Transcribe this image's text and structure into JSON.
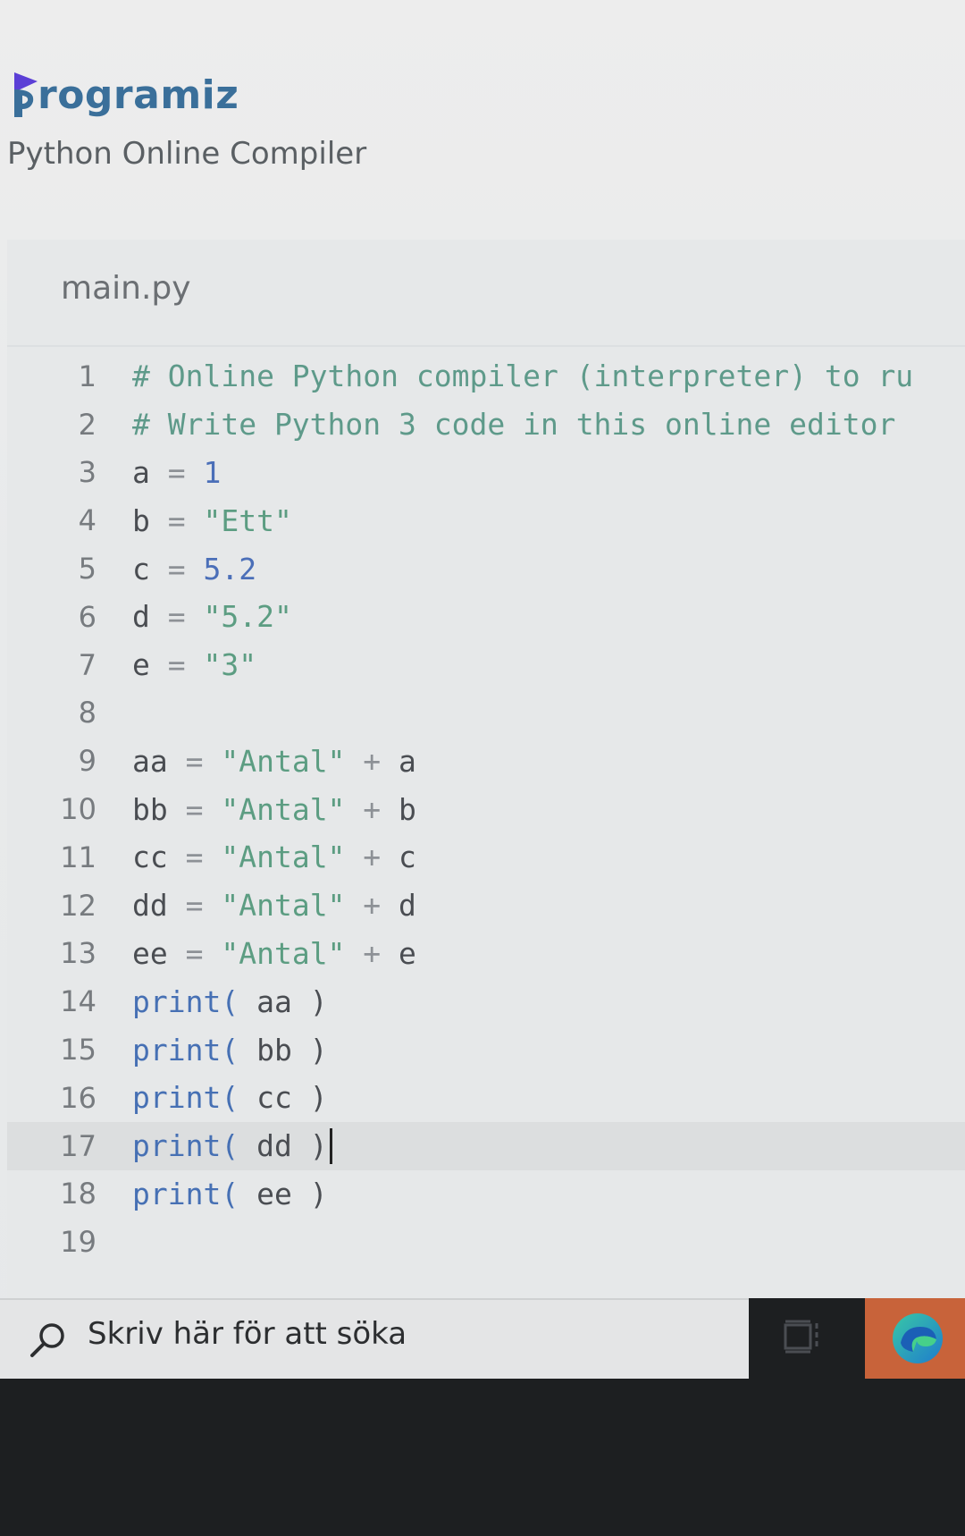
{
  "header": {
    "logo_text": "rogramiz",
    "subtitle": "Python Online Compiler"
  },
  "editor": {
    "file_tab": "main.py",
    "active_line": 17,
    "lines": [
      {
        "n": "1",
        "tokens": [
          {
            "t": "# Online Python compiler (interpreter) to ru",
            "c": "comment"
          }
        ]
      },
      {
        "n": "2",
        "tokens": [
          {
            "t": "# Write Python 3 code in this online editor",
            "c": "comment"
          }
        ]
      },
      {
        "n": "3",
        "tokens": [
          {
            "t": "a ",
            "c": "plain"
          },
          {
            "t": "=",
            "c": "op"
          },
          {
            "t": " 1",
            "c": "num"
          }
        ]
      },
      {
        "n": "4",
        "tokens": [
          {
            "t": "b ",
            "c": "plain"
          },
          {
            "t": "=",
            "c": "op"
          },
          {
            "t": " \"Ett\"",
            "c": "str"
          }
        ]
      },
      {
        "n": "5",
        "tokens": [
          {
            "t": "c ",
            "c": "plain"
          },
          {
            "t": "=",
            "c": "op"
          },
          {
            "t": " 5.2",
            "c": "num"
          }
        ]
      },
      {
        "n": "6",
        "tokens": [
          {
            "t": "d ",
            "c": "plain"
          },
          {
            "t": "=",
            "c": "op"
          },
          {
            "t": " \"5.2\"",
            "c": "str"
          }
        ]
      },
      {
        "n": "7",
        "tokens": [
          {
            "t": "e ",
            "c": "plain"
          },
          {
            "t": "=",
            "c": "op"
          },
          {
            "t": " \"3\"",
            "c": "str"
          }
        ]
      },
      {
        "n": "8",
        "tokens": []
      },
      {
        "n": "9",
        "tokens": [
          {
            "t": "aa ",
            "c": "plain"
          },
          {
            "t": "=",
            "c": "op"
          },
          {
            "t": " \"Antal\"",
            "c": "str"
          },
          {
            "t": " + ",
            "c": "op"
          },
          {
            "t": "a",
            "c": "plain"
          }
        ]
      },
      {
        "n": "10",
        "tokens": [
          {
            "t": "bb ",
            "c": "plain"
          },
          {
            "t": "=",
            "c": "op"
          },
          {
            "t": " \"Antal\"",
            "c": "str"
          },
          {
            "t": " + ",
            "c": "op"
          },
          {
            "t": "b",
            "c": "plain"
          }
        ]
      },
      {
        "n": "11",
        "tokens": [
          {
            "t": "cc ",
            "c": "plain"
          },
          {
            "t": "=",
            "c": "op"
          },
          {
            "t": " \"Antal\"",
            "c": "str"
          },
          {
            "t": " + ",
            "c": "op"
          },
          {
            "t": "c",
            "c": "plain"
          }
        ]
      },
      {
        "n": "12",
        "tokens": [
          {
            "t": "dd ",
            "c": "plain"
          },
          {
            "t": "=",
            "c": "op"
          },
          {
            "t": " \"Antal\"",
            "c": "str"
          },
          {
            "t": " + ",
            "c": "op"
          },
          {
            "t": "d",
            "c": "plain"
          }
        ]
      },
      {
        "n": "13",
        "tokens": [
          {
            "t": "ee ",
            "c": "plain"
          },
          {
            "t": "=",
            "c": "op"
          },
          {
            "t": " \"Antal\"",
            "c": "str"
          },
          {
            "t": " + ",
            "c": "op"
          },
          {
            "t": "e",
            "c": "plain"
          }
        ]
      },
      {
        "n": "14",
        "tokens": [
          {
            "t": "print(",
            "c": "func"
          },
          {
            "t": " aa )",
            "c": "plain"
          }
        ]
      },
      {
        "n": "15",
        "tokens": [
          {
            "t": "print(",
            "c": "func"
          },
          {
            "t": " bb )",
            "c": "plain"
          }
        ]
      },
      {
        "n": "16",
        "tokens": [
          {
            "t": "print(",
            "c": "func"
          },
          {
            "t": " cc )",
            "c": "plain"
          }
        ]
      },
      {
        "n": "17",
        "tokens": [
          {
            "t": "print(",
            "c": "func"
          },
          {
            "t": " dd )",
            "c": "plain"
          }
        ]
      },
      {
        "n": "18",
        "tokens": [
          {
            "t": "print(",
            "c": "func"
          },
          {
            "t": " ee )",
            "c": "plain"
          }
        ]
      },
      {
        "n": "19",
        "tokens": []
      }
    ]
  },
  "taskbar": {
    "search_placeholder": "Skriv här för att söka",
    "icons": [
      "search-icon",
      "task-view-icon",
      "edge-icon"
    ],
    "edge_tile_color": "#c8633a"
  },
  "colors": {
    "brand": "#3a6f9a",
    "brand_accent": "#5b3fd6",
    "comment": "#5e9a8a",
    "string": "#5c9d82",
    "number": "#4b6fb8",
    "function": "#4670b4"
  }
}
